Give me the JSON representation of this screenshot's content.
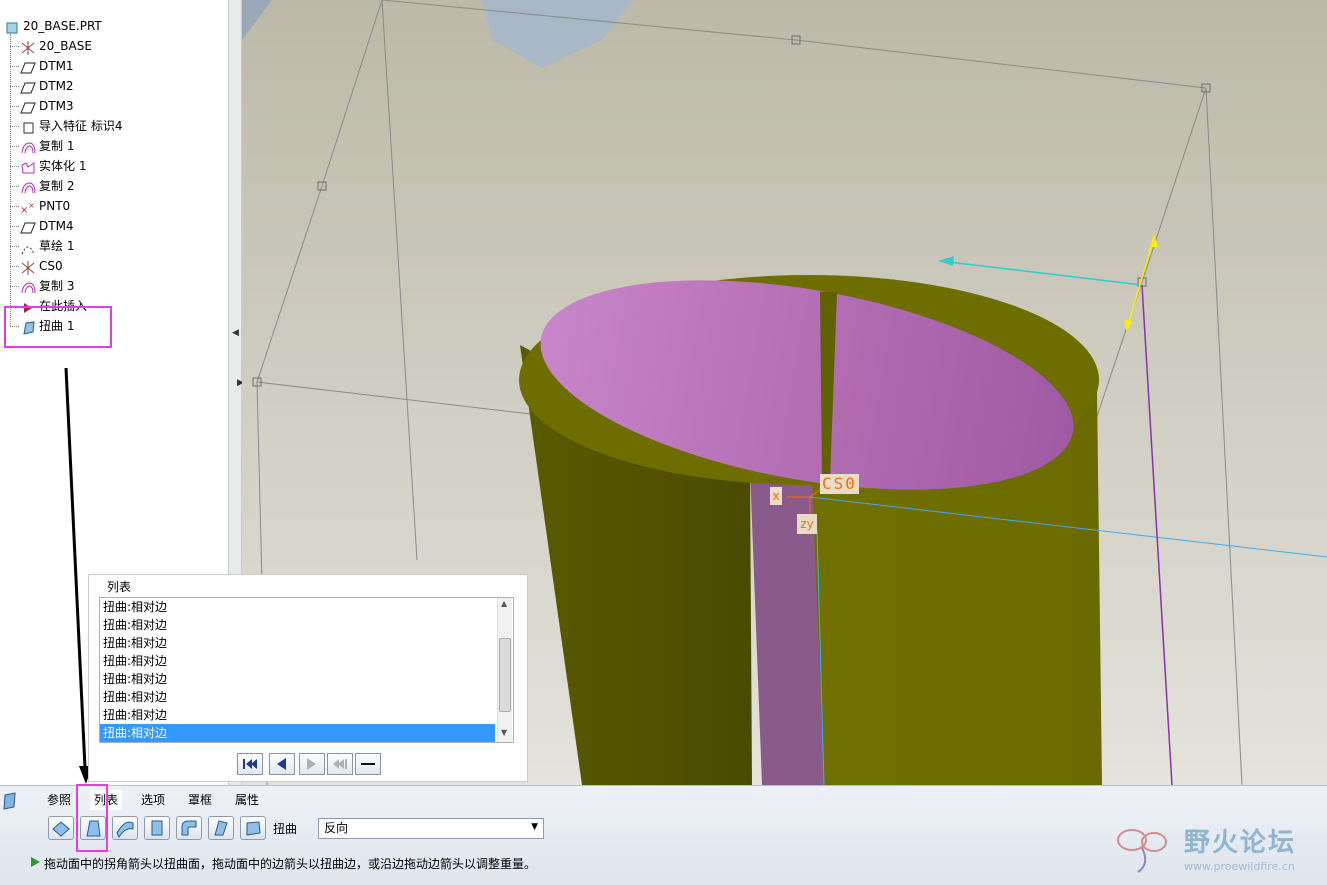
{
  "model_tree": {
    "items": [
      {
        "label": "20_BASE.PRT",
        "icon": "part-icon"
      },
      {
        "label": "20_BASE",
        "icon": "csys-icon"
      },
      {
        "label": "DTM1",
        "icon": "datum-plane-icon"
      },
      {
        "label": "DTM2",
        "icon": "datum-plane-icon"
      },
      {
        "label": "DTM3",
        "icon": "datum-plane-icon"
      },
      {
        "label": "导入特征 标识4",
        "icon": "import-feature-icon"
      },
      {
        "label": "复制 1",
        "icon": "copy-surface-icon"
      },
      {
        "label": "实体化 1",
        "icon": "solidify-icon"
      },
      {
        "label": "复制 2",
        "icon": "copy-surface-icon"
      },
      {
        "label": "PNT0",
        "icon": "datum-point-icon"
      },
      {
        "label": "DTM4",
        "icon": "datum-plane-icon"
      },
      {
        "label": "草绘 1",
        "icon": "sketch-icon"
      },
      {
        "label": "CS0",
        "icon": "csys-icon"
      },
      {
        "label": "复制 3",
        "icon": "copy-surface-icon"
      },
      {
        "label": "在此插入",
        "icon": "insert-here-arrow-icon"
      },
      {
        "label": "扭曲 1",
        "icon": "warp-feature-icon"
      }
    ]
  },
  "viewport": {
    "csys_label": "CS0",
    "axis_x": "x",
    "axis_zy": "zy"
  },
  "list_panel": {
    "title": "列表",
    "items": [
      "扭曲:相对边",
      "扭曲:相对边",
      "扭曲:相对边",
      "扭曲:相对边",
      "扭曲:相对边",
      "扭曲:相对边",
      "扭曲:相对边",
      "扭曲:相对边"
    ],
    "selected_index": 7
  },
  "dashboard": {
    "tabs": [
      "参照",
      "列表",
      "选项",
      "罩框",
      "属性"
    ],
    "active_tab": "列表",
    "tool_label": "扭曲",
    "direction_select": "反向",
    "status": "拖动面中的拐角箭头以扭曲面，拖动面中的边箭头以扭曲边，或沿边拖动边箭头以调整重量。"
  },
  "watermark": {
    "title": "野火论坛",
    "url": "www.proewildfire.cn"
  },
  "colors": {
    "highlight": "#e040e0",
    "selection": "#3399ff",
    "surface_olive": "#6b6b00",
    "surface_pink": "#c07ac0"
  }
}
